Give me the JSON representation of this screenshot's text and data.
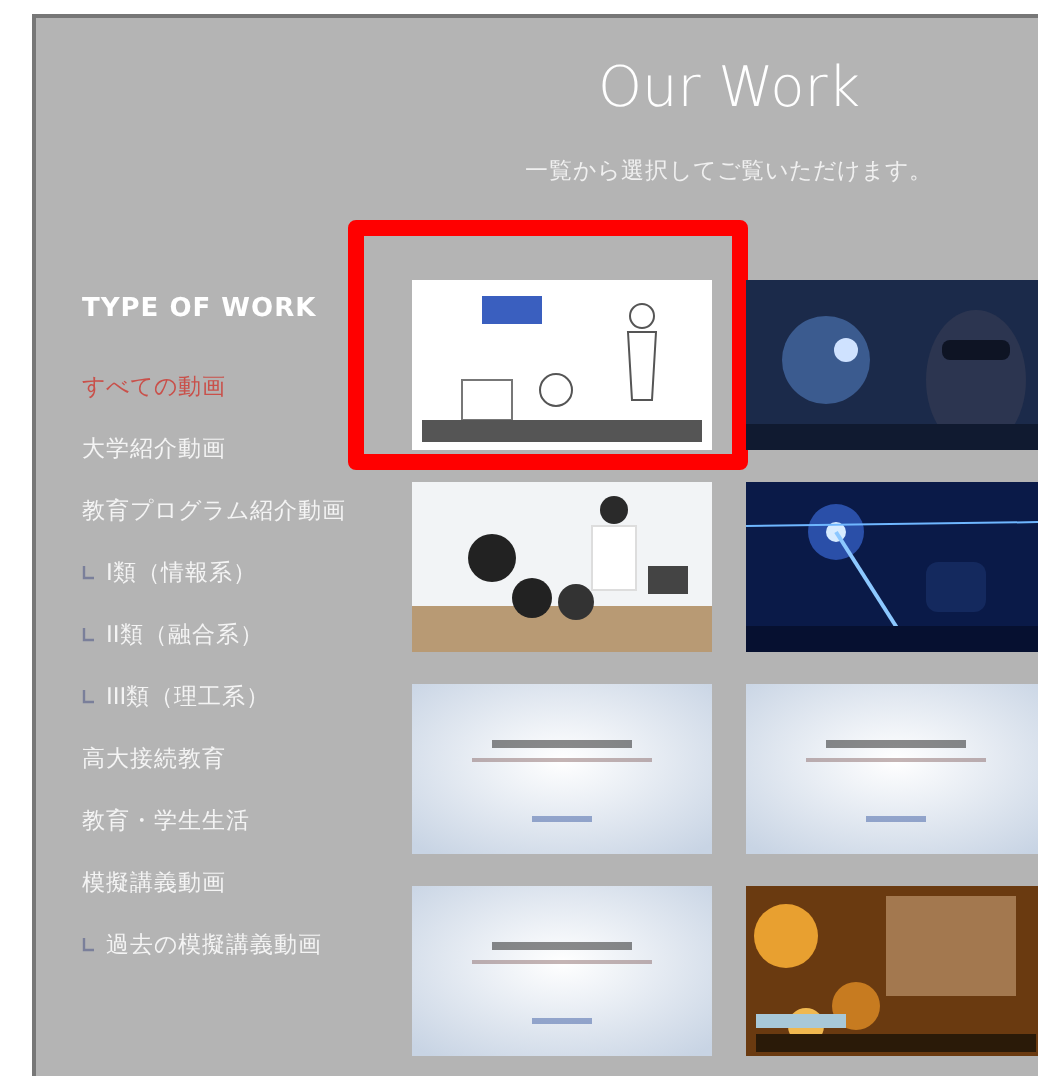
{
  "header": {
    "title": "Our Work",
    "subtitle": "一覧から選択してご覧いただけます。"
  },
  "sidebar": {
    "heading": "TYPE OF WORK",
    "items": [
      {
        "label": "すべての動画",
        "selected": true
      },
      {
        "label": "大学紹介動画",
        "selected": false
      },
      {
        "label": "教育プログラム紹介動画",
        "selected": false,
        "children": [
          {
            "label": "I類（情報系）",
            "selected": false
          },
          {
            "label": "II類（融合系）",
            "selected": false
          },
          {
            "label": "III類（理工系）",
            "selected": false
          }
        ]
      },
      {
        "label": "高大接続教育",
        "selected": false
      },
      {
        "label": "教育・学生生活",
        "selected": false
      },
      {
        "label": "模擬講義動画",
        "selected": false,
        "children": [
          {
            "label": "過去の模擬講義動画",
            "selected": false
          }
        ]
      }
    ]
  },
  "videos": [
    {
      "kind": "picture",
      "highlighted": true
    },
    {
      "kind": "picture",
      "highlighted": false
    },
    {
      "kind": "picture",
      "highlighted": false
    },
    {
      "kind": "picture",
      "highlighted": false
    },
    {
      "kind": "picture",
      "highlighted": false
    },
    {
      "kind": "picture",
      "highlighted": false
    },
    {
      "kind": "picture",
      "highlighted": false
    },
    {
      "kind": "picture",
      "highlighted": false
    }
  ]
}
